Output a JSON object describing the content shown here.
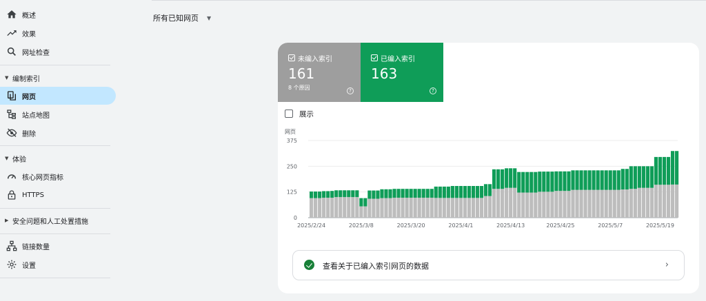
{
  "sidebar": {
    "top_items": [
      {
        "label": "概述",
        "icon": "home-icon"
      },
      {
        "label": "效果",
        "icon": "trending-up-icon"
      },
      {
        "label": "网址检查",
        "icon": "search-icon"
      }
    ],
    "section_indexing": {
      "label": "编制索引",
      "caret": "▼"
    },
    "indexing_items": [
      {
        "label": "网页",
        "icon": "pages-icon",
        "active": true
      },
      {
        "label": "站点地图",
        "icon": "sitemap-icon"
      },
      {
        "label": "删除",
        "icon": "eye-off-icon"
      }
    ],
    "section_experience": {
      "label": "体验",
      "caret": "▼"
    },
    "experience_items": [
      {
        "label": "核心网页指标",
        "icon": "speed-gauge-icon"
      },
      {
        "label": "HTTPS",
        "icon": "lock-icon"
      }
    ],
    "section_security": {
      "label": "安全问题和人工处置措施",
      "caret": "▶"
    },
    "bottom_items": [
      {
        "label": "链接数量",
        "icon": "links-icon"
      },
      {
        "label": "设置",
        "icon": "gear-icon"
      }
    ]
  },
  "filter": {
    "label": "所有已知网页",
    "caret": "▼"
  },
  "stats": {
    "not_indexed": {
      "title": "未编入索引",
      "value": "161",
      "sub": "8 个原因",
      "help": "?",
      "color": "#9e9e9e"
    },
    "indexed": {
      "title": "已编入索引",
      "value": "163",
      "help": "?",
      "color": "#0f9d58"
    }
  },
  "show_toggle": {
    "label": "展示",
    "checked": false
  },
  "chart_data": {
    "type": "bar",
    "stacked": true,
    "ylabel": "网页",
    "yticks": [
      0,
      125,
      250,
      375
    ],
    "ylim": [
      0,
      375
    ],
    "xtick_labels": [
      "2025/2/24",
      "2025/3/8",
      "2025/3/20",
      "2025/4/1",
      "2025/4/13",
      "2025/4/25",
      "2025/5/7",
      "2025/5/19"
    ],
    "xtick_indices": [
      0,
      12,
      24,
      36,
      48,
      60,
      72,
      84
    ],
    "series": [
      {
        "name": "未编入索引",
        "color": "#bdbdbd",
        "values": [
          95,
          95,
          95,
          97,
          97,
          97,
          100,
          100,
          100,
          100,
          100,
          100,
          55,
          55,
          92,
          92,
          92,
          95,
          95,
          95,
          97,
          97,
          97,
          97,
          97,
          97,
          97,
          97,
          97,
          97,
          96,
          96,
          96,
          96,
          96,
          96,
          96,
          96,
          96,
          96,
          96,
          96,
          105,
          105,
          140,
          140,
          140,
          145,
          145,
          145,
          122,
          122,
          122,
          122,
          122,
          126,
          126,
          126,
          126,
          130,
          130,
          130,
          130,
          135,
          135,
          135,
          135,
          135,
          135,
          135,
          135,
          135,
          135,
          135,
          135,
          137,
          137,
          140,
          140,
          145,
          145,
          145,
          145,
          160,
          160,
          160,
          160,
          161,
          161
        ]
      },
      {
        "name": "已编入索引",
        "color": "#0f9d58",
        "values": [
          32,
          32,
          32,
          32,
          32,
          33,
          33,
          33,
          33,
          33,
          33,
          33,
          40,
          40,
          40,
          40,
          40,
          43,
          43,
          43,
          43,
          43,
          43,
          43,
          43,
          43,
          43,
          43,
          43,
          43,
          55,
          55,
          55,
          55,
          58,
          58,
          58,
          58,
          58,
          58,
          58,
          58,
          58,
          58,
          95,
          95,
          95,
          95,
          95,
          95,
          100,
          100,
          100,
          100,
          100,
          98,
          98,
          98,
          98,
          95,
          95,
          95,
          95,
          95,
          95,
          95,
          95,
          95,
          95,
          95,
          95,
          95,
          95,
          95,
          95,
          100,
          100,
          110,
          110,
          105,
          105,
          105,
          105,
          135,
          135,
          135,
          135,
          163,
          163
        ]
      }
    ]
  },
  "data_link": {
    "label": "查看关于已编入索引网页的数据",
    "chevron": "›"
  }
}
